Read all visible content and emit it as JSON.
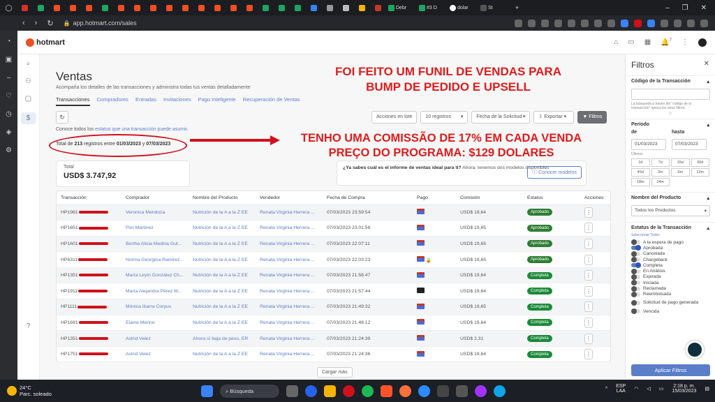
{
  "browser": {
    "tabs": [
      "",
      "M",
      "",
      "",
      "",
      "",
      "",
      "",
      "",
      "",
      "",
      "",
      "",
      "",
      "",
      "",
      "",
      "",
      "",
      "",
      "",
      "",
      "",
      "",
      "",
      "",
      "",
      "",
      "Debr",
      "#3 D",
      "dolar",
      "St"
    ],
    "url": "app.hotmart.com/sales"
  },
  "app": {
    "name": "hotmart",
    "notifications": "7"
  },
  "page": {
    "title": "Ventas",
    "subtitle": "Acompaña los detalles de las transacciones y administra todas tus ventas detalladamente",
    "tabs": [
      "Transacciones",
      "Compradores",
      "Entradas",
      "Invitaciones",
      "Pago Inteligente",
      "Recuperación de Ventas"
    ]
  },
  "toolbar": {
    "bulk_actions": "Acciones en lote",
    "per_page": "10 registros",
    "date_type": "Fecha de la Solicitud",
    "export": "Exportar",
    "filters": "Filtros"
  },
  "intro": {
    "prefix": "Conoce todos los",
    "link": "estatus que una transacción puede asumir."
  },
  "range": {
    "prefix": "Total de",
    "count": "213",
    "mid": "registros entre",
    "start": "01/03/2023",
    "and": "y",
    "end": "07/03/2023"
  },
  "total_card": {
    "label": "Total",
    "value": "USD$ 3.747,92"
  },
  "info_card": {
    "bold": "¿Ya sabes cuál es el informe de ventas ideal para ti?",
    "text": "Ahora, tenemos dos modelos disponibles",
    "button": "Conocer modelos"
  },
  "table": {
    "headers": [
      "Transacción",
      "Comprador",
      "Nombre del Producto",
      "Vendedor",
      "Fecha de Compra",
      "Pago",
      "Comisión",
      "Estatus",
      "Acciones"
    ],
    "rows": [
      {
        "tx": "HP1961",
        "buyer": "Veronica Mendoza",
        "product": "Nutrición de la A a la Z EE",
        "seller": "Renata Virginia Herrera ...",
        "date": "07/03/2023 23:59:54",
        "commission": "USD$ 19,64",
        "status": "Aprobado"
      },
      {
        "tx": "HP1651",
        "buyer": "Flor Martinez",
        "product": "Nutrición de la A a la Z EE",
        "seller": "Renata Virginia Herrera ...",
        "date": "07/03/2023 23:01:58",
        "commission": "USD$ 19,65",
        "status": "Aprobado"
      },
      {
        "tx": "HP1601",
        "buyer": "Bertha Alicia Medina Gut...",
        "product": "Nutrición de la A a la Z EE",
        "seller": "Renata Virginia Herrera ...",
        "date": "07/03/2023 22:07:11",
        "commission": "USD$ 19,65",
        "status": "Aprobado"
      },
      {
        "tx": "HP6311",
        "buyer": "Norma Georgina Ramirez...",
        "product": "Nutrición de la A a la Z EE",
        "seller": "Renata Virginia Herrera ...",
        "date": "07/03/2023 22:03:23",
        "commission": "USD$ 19,65",
        "status": "Aprobado"
      },
      {
        "tx": "HP1351",
        "buyer": "María Leyín González Ch...",
        "product": "Nutrición de la A a la Z EE",
        "seller": "Renata Virginia Herrera ...",
        "date": "07/03/2023 21:58:47",
        "commission": "USD$ 19,64",
        "status": "Completa"
      },
      {
        "tx": "HP1911",
        "buyer": "María Alejandra Pérez M...",
        "product": "Nutrición de la A a la Z EE",
        "seller": "Renata Virginia Herrera ...",
        "date": "07/03/2023 21:57:44",
        "commission": "USD$ 19,64",
        "status": "Completa"
      },
      {
        "tx": "HP1111",
        "buyer": "Mónica Ibarra Corpus",
        "product": "Nutrición de la A a la Z EE",
        "seller": "Renata Virginia Herrera ...",
        "date": "07/03/2023 21:49:32",
        "commission": "USD$ 19,65",
        "status": "Completa"
      },
      {
        "tx": "HP1691",
        "buyer": "Elaine Merino",
        "product": "Nutrición de la A a la Z EE",
        "seller": "Renata Virginia Herrera ...",
        "date": "07/03/2023 21:48:12",
        "commission": "USD$ 19,64",
        "status": "Completa"
      },
      {
        "tx": "HP1351",
        "buyer": "Astrid Velez",
        "product": "Ahora sí baja de peso, ER",
        "seller": "Renata Virginia Herrera ...",
        "date": "07/03/2023 21:24:39",
        "commission": "USD$ 2,31",
        "status": "Completa"
      },
      {
        "tx": "HP1751",
        "buyer": "Astrid Velez",
        "product": "Nutrición de la A a la Z EE",
        "seller": "Renata Virginia Herrera ...",
        "date": "07/03/2023 21:24:36",
        "commission": "USD$ 19,64",
        "status": "Completa"
      }
    ],
    "load_more": "Cargar más"
  },
  "annotations": {
    "funnel_line1": "FOI FEITO UM FUNIL DE VENDAS PARA",
    "funnel_line2": "BUMP DE PEDIDO E UPSELL",
    "commission_line1": "TENHO UMA COMISSÃO DE 17% EM CADA VENDA",
    "commission_line2": "PREÇO DO PROGRAMA: $129 DOLARES"
  },
  "filters": {
    "title": "Filtros",
    "tx_code_label": "Código de la Transacción",
    "tx_code_help": "La búsqueda a través del \"código de la transacción\" ignora los otros filtros.",
    "period_label": "Período",
    "from_label": "de",
    "to_label": "hasta",
    "from_value": "01/03/2023",
    "to_value": "07/03/2023",
    "last_label": "Últimos",
    "ranges": [
      "1d",
      "7d",
      "15d",
      "30d",
      "45d",
      "3m",
      "6m",
      "12m",
      "18m",
      "24m"
    ],
    "product_label": "Nombre del Producto",
    "product_value": "Todos los Productos",
    "status_label": "Estatus de la Transacción",
    "select_all": "Seleccionar Todos",
    "statuses": [
      {
        "label": "A la espera de pago",
        "on": false
      },
      {
        "label": "Aprobada",
        "on": true
      },
      {
        "label": "Cancelada",
        "on": false
      },
      {
        "label": "Chargeback",
        "on": false
      },
      {
        "label": "Completa",
        "on": true
      },
      {
        "label": "En Análisis",
        "on": false
      },
      {
        "label": "Expirada",
        "on": false
      },
      {
        "label": "Iniciada",
        "on": false
      },
      {
        "label": "Reclamada",
        "on": false
      },
      {
        "label": "Reembolsada",
        "on": false
      },
      {
        "label": "Solicitud de pago generada",
        "on": false
      },
      {
        "label": "Vencida",
        "on": false
      }
    ],
    "apply": "Aplicar Filtros"
  },
  "taskbar": {
    "temp": "24°C",
    "weather": "Parc. soleado",
    "search": "Búsqueda",
    "lang1": "ESP",
    "lang2": "LAA",
    "time": "2:18 p. m.",
    "date": "15/03/2023"
  },
  "colors": {
    "approved": "#2e7d32",
    "complete": "#1b8a3a",
    "accent": "#5a7ec8",
    "annotation": "#e01b1b"
  }
}
